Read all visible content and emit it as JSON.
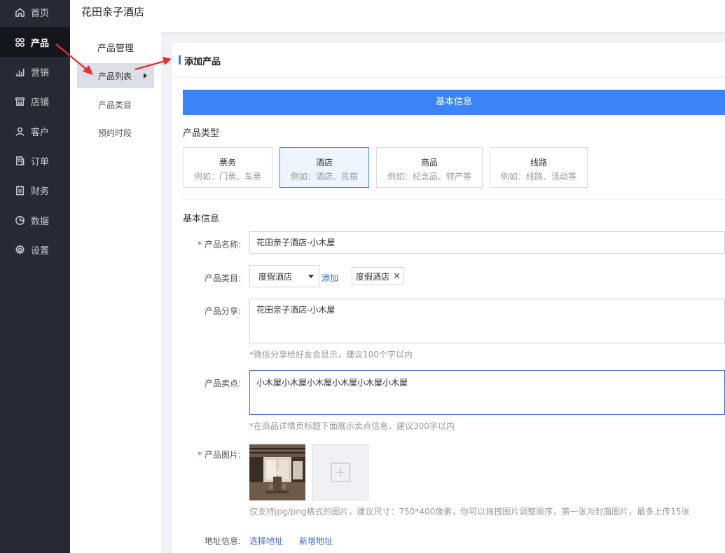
{
  "nav": {
    "items": [
      {
        "label": "首页",
        "icon": "home-icon"
      },
      {
        "label": "产品",
        "icon": "product-icon",
        "active": true
      },
      {
        "label": "营销",
        "icon": "bar-chart-icon"
      },
      {
        "label": "店铺",
        "icon": "store-icon"
      },
      {
        "label": "客户",
        "icon": "user-icon"
      },
      {
        "label": "订单",
        "icon": "order-icon"
      },
      {
        "label": "财务",
        "icon": "finance-icon"
      },
      {
        "label": "数据",
        "icon": "pie-chart-icon"
      },
      {
        "label": "设置",
        "icon": "gear-icon"
      }
    ]
  },
  "header": {
    "title": "花田亲子酒店"
  },
  "subnav": {
    "title": "产品管理",
    "items": [
      {
        "label": "产品列表",
        "active": true
      },
      {
        "label": "产品类目"
      },
      {
        "label": "预约时段"
      }
    ]
  },
  "main": {
    "section_title": "添加产品",
    "banner": "基本信息",
    "product_type_label": "产品类型",
    "product_types": [
      {
        "name": "票务",
        "example": "例如：门票、车票"
      },
      {
        "name": "酒店",
        "example": "例如：酒店、民宿",
        "selected": true
      },
      {
        "name": "商品",
        "example": "例如：纪念品、特产等"
      },
      {
        "name": "线路",
        "example": "例如：线路、活动等"
      }
    ],
    "basic_info_label": "基本信息",
    "form": {
      "name_label": "产品名称:",
      "name_value": "花田亲子酒店-小木屋",
      "category_label": "产品类目:",
      "category_selected": "度假酒店",
      "category_add": "添加",
      "category_tag": "度假酒店",
      "share_label": "产品分享:",
      "share_value": "花田亲子酒店-小木屋",
      "share_hint": "*微信分享给好友会显示，建议100个字以内",
      "selling_label": "产品卖点:",
      "selling_value": "小木屋小木屋小木屋小木屋小木屋小木屋",
      "selling_hint": "*在商品详情页标题下面展示卖点信息，建议300字以内",
      "image_label": "产品图片:",
      "image_hint": "仅支持jpg/png格式的图片，建议尺寸：750*400像素，你可以拖拽图片调整顺序，第一张为封面图片，最多上传15张",
      "address_label": "地址信息:",
      "address_select": "选择地址",
      "address_new": "新增地址"
    }
  },
  "colors": {
    "nav_bg": "#262a35",
    "nav_active": "#14161d",
    "accent": "#3c84f7",
    "link": "#3c6ddb",
    "required": "#e2312f",
    "arrow": "#e8302a"
  }
}
